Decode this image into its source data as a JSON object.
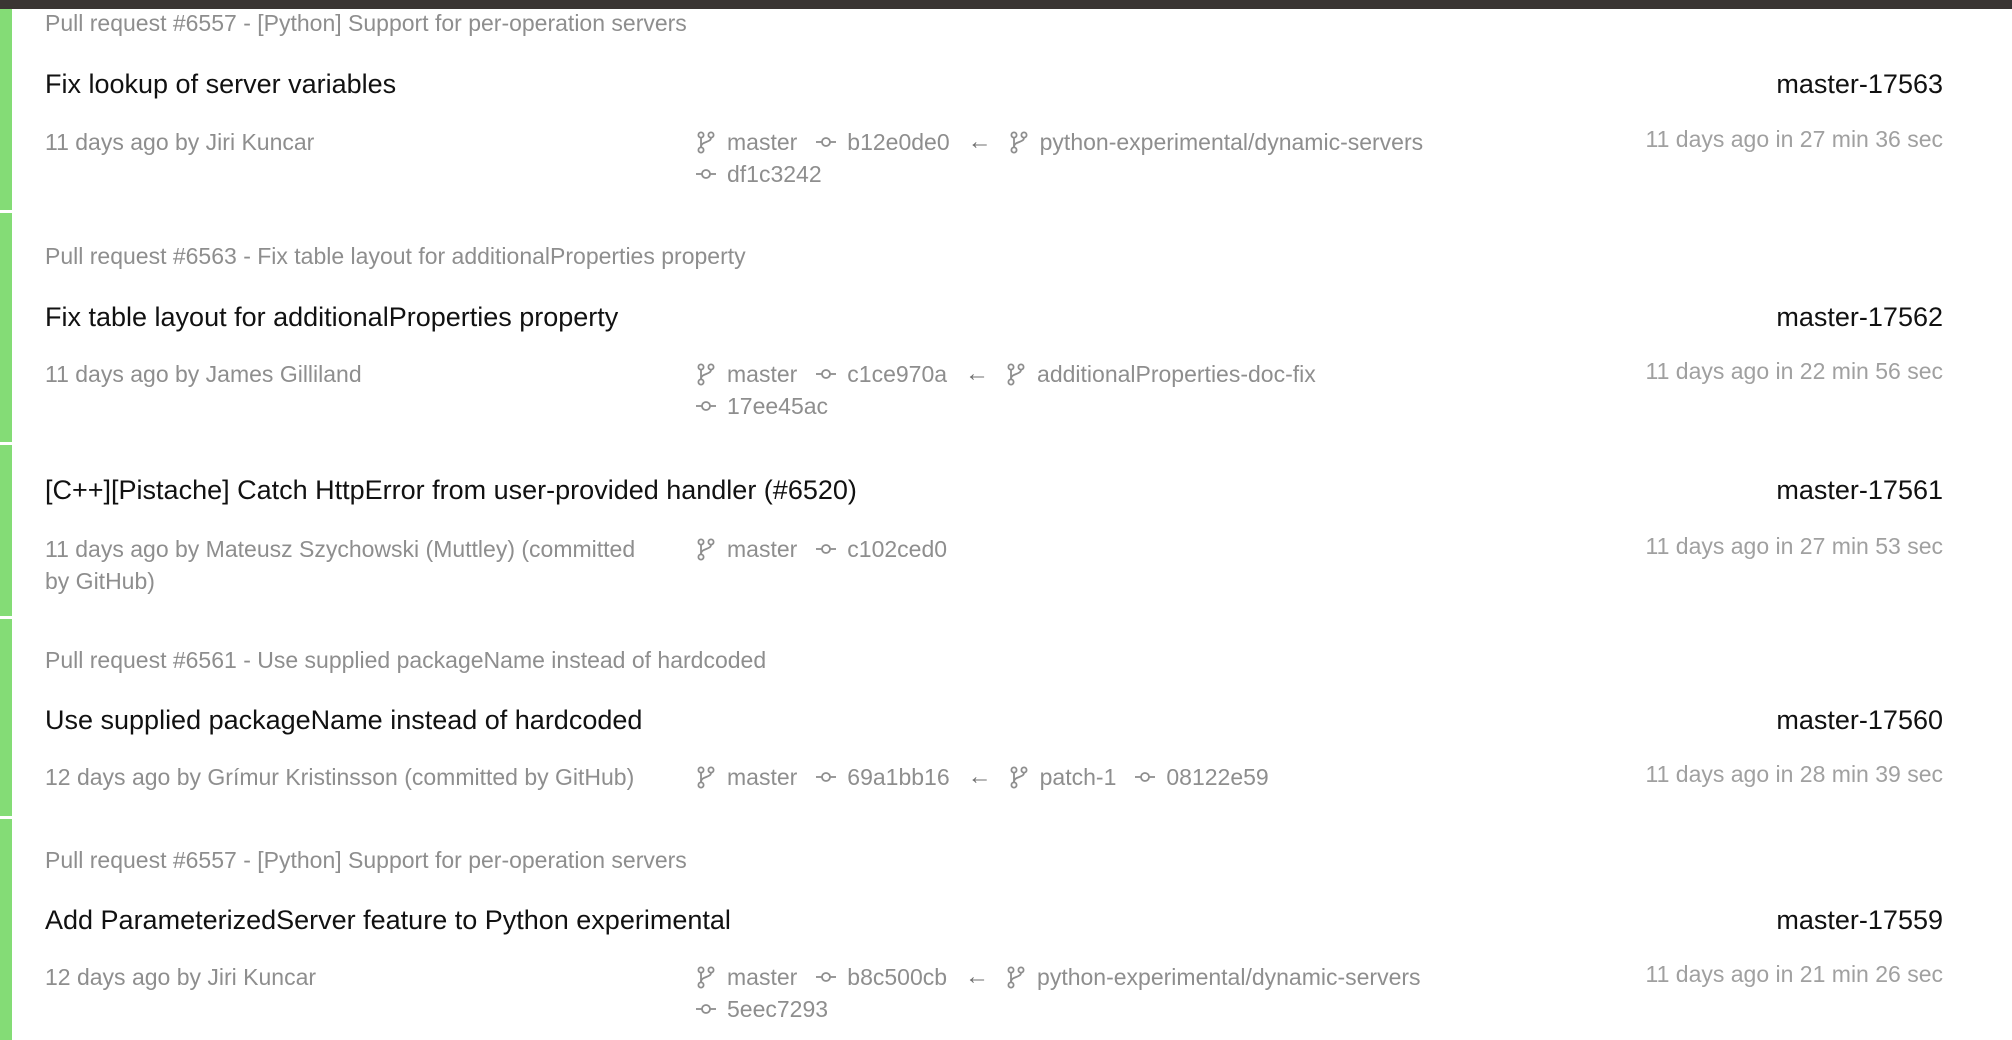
{
  "builds": [
    {
      "pr": "Pull request #6557 - [Python] Support for per-operation servers",
      "title": "Fix lookup of server variables",
      "number": "master-17563",
      "meta": "11 days ago by Jiri Kuncar",
      "target_branch": "master",
      "target_commit": "b12e0de0",
      "arrow": "←",
      "source_branch": "python-experimental/dynamic-servers",
      "source_commit": "df1c3242",
      "finished": "11 days ago in 27 min 36 sec",
      "status_color": "#84dc76"
    },
    {
      "pr": "Pull request #6563 - Fix table layout for additionalProperties property",
      "title": "Fix table layout for additionalProperties property",
      "number": "master-17562",
      "meta": "11 days ago by James Gilliland",
      "target_branch": "master",
      "target_commit": "c1ce970a",
      "arrow": "←",
      "source_branch": "additionalProperties-doc-fix",
      "source_commit": "17ee45ac",
      "finished": "11 days ago in 22 min 56 sec",
      "status_color": "#84dc76"
    },
    {
      "pr": "",
      "title": "[C++][Pistache] Catch HttpError from user-provided handler (#6520)",
      "number": "master-17561",
      "meta": "11 days ago by Mateusz Szychowski (Muttley) (committed by GitHub)",
      "target_branch": "master",
      "target_commit": "c102ced0",
      "finished": "11 days ago in 27 min 53 sec",
      "status_color": "#84dc76"
    },
    {
      "pr": "Pull request #6561 - Use supplied packageName instead of hardcoded",
      "title": "Use supplied packageName instead of hardcoded",
      "number": "master-17560",
      "meta": "12 days ago by Grímur Kristinsson (committed by GitHub)",
      "target_branch": "master",
      "target_commit": "69a1bb16",
      "arrow": "←",
      "source_branch": "patch-1",
      "source_commit": "08122e59",
      "finished": "11 days ago in 28 min 39 sec",
      "status_color": "#84dc76"
    },
    {
      "pr": "Pull request #6557 - [Python] Support for per-operation servers",
      "title": "Add ParameterizedServer feature to Python experimental",
      "number": "master-17559",
      "meta": "12 days ago by Jiri Kuncar",
      "target_branch": "master",
      "target_commit": "b8c500cb",
      "arrow": "←",
      "source_branch": "python-experimental/dynamic-servers",
      "source_commit": "5eec7293",
      "finished": "11 days ago in 21 min 26 sec",
      "status_color": "#84dc76"
    }
  ]
}
